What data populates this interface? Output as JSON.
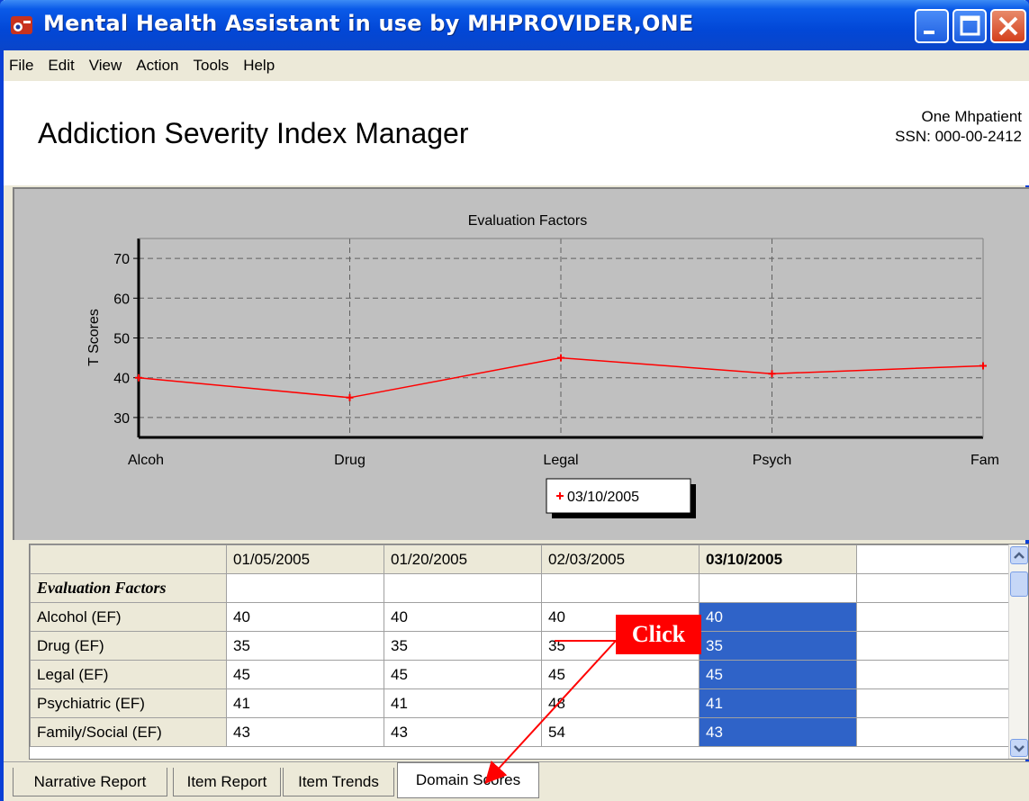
{
  "window": {
    "title": "Mental Health Assistant in use by MHPROVIDER,ONE",
    "icon": "app-icon"
  },
  "menu": [
    "File",
    "Edit",
    "View",
    "Action",
    "Tools",
    "Help"
  ],
  "header": {
    "title": "Addiction Severity Index Manager",
    "patient_name": "One Mhpatient",
    "patient_ssn": "SSN: 000-00-2412"
  },
  "chart_data": {
    "type": "line",
    "title": "Evaluation Factors",
    "ylabel": "T Scores",
    "xlabel": "",
    "categories": [
      "Alcoh",
      "Drug",
      "Legal",
      "Psych",
      "Fam"
    ],
    "series": [
      {
        "name": "03/10/2005",
        "values": [
          40,
          35,
          45,
          41,
          43
        ],
        "color": "#ff0000"
      }
    ],
    "ylim": [
      25,
      75
    ],
    "yticks": [
      30,
      40,
      50,
      60,
      70
    ],
    "grid": true,
    "legend": "bottom-center"
  },
  "table": {
    "columns": [
      "01/05/2005",
      "01/20/2005",
      "02/03/2005",
      "03/10/2005"
    ],
    "selected_column": "03/10/2005",
    "section_label": "Evaluation Factors",
    "rows": [
      {
        "label": "Alcohol (EF)",
        "values": [
          "40",
          "40",
          "40",
          "40"
        ]
      },
      {
        "label": "Drug (EF)",
        "values": [
          "35",
          "35",
          "35",
          "35"
        ]
      },
      {
        "label": "Legal (EF)",
        "values": [
          "45",
          "45",
          "45",
          "45"
        ]
      },
      {
        "label": "Psychiatric (EF)",
        "values": [
          "41",
          "41",
          "48",
          "41"
        ]
      },
      {
        "label": "Family/Social (EF)",
        "values": [
          "43",
          "43",
          "54",
          "43"
        ]
      }
    ]
  },
  "tabs": [
    {
      "label": "Narrative Report",
      "active": false
    },
    {
      "label": "Item Report",
      "active": false
    },
    {
      "label": "Item Trends",
      "active": false
    },
    {
      "label": "Domain Scores",
      "active": true
    }
  ],
  "annotation": {
    "label": "Click"
  },
  "colors": {
    "accent": "#2f63c8",
    "series": "#ff0000",
    "titlebar": "#0247d6"
  }
}
